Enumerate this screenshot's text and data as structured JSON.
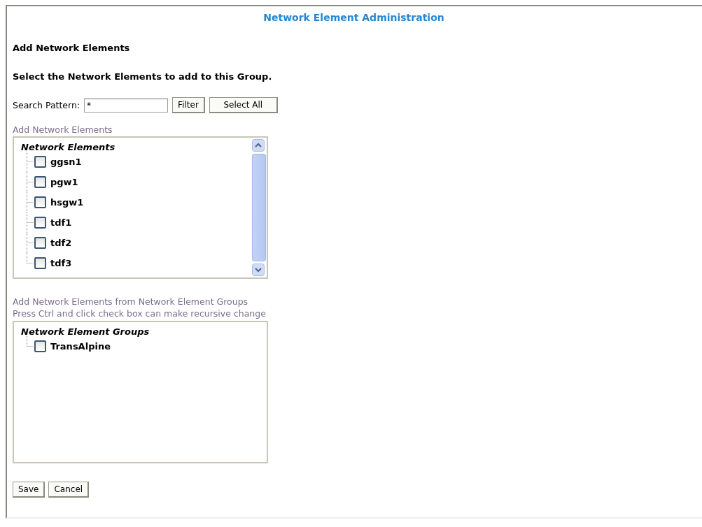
{
  "title": "Network Element Administration",
  "heading": "Add Network Elements",
  "instruction": "Select the Network Elements to add to this Group.",
  "search": {
    "label": "Search Pattern:",
    "value": "*",
    "buttons": [
      "Filter",
      "Select All"
    ]
  },
  "elements_section": {
    "label": "Add Network Elements",
    "tree": {
      "title": "Network Elements",
      "children": [
        {
          "label": "ggsn1",
          "checked": false
        },
        {
          "label": "pgw1",
          "checked": false
        },
        {
          "label": "hsgw1",
          "checked": false
        },
        {
          "label": "tdf1",
          "checked": false
        },
        {
          "label": "tdf2",
          "checked": false
        },
        {
          "label": "tdf3",
          "checked": false
        }
      ]
    }
  },
  "groups_section": {
    "label_lines": [
      "Add Network Elements from Network Element Groups",
      "Press Ctrl and click check box can make recursive change"
    ],
    "tree": {
      "title": "Network Element Groups",
      "children": [
        {
          "label": "TransAlpine",
          "checked": false
        }
      ]
    }
  },
  "buttons": [
    "Save",
    "Cancel"
  ]
}
